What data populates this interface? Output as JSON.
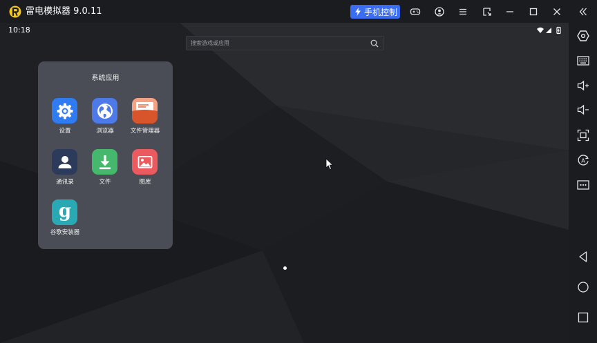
{
  "window": {
    "title": "雷电模拟器 9.0.11",
    "phone_control_label": "手机控制",
    "accent_color": "#3b6df2",
    "logo_color": "#f5c518",
    "buttons": [
      "gamepad-icon",
      "user-icon",
      "menu-icon",
      "screen-resize-icon",
      "minimize-icon",
      "maximize-icon",
      "close-icon",
      "collapse-sidebar-icon"
    ]
  },
  "status_bar": {
    "time": "10:18",
    "icons": [
      "wifi-icon",
      "signal-icon",
      "battery-icon"
    ]
  },
  "search": {
    "placeholder": "搜索游戏或应用"
  },
  "folder": {
    "title": "系统应用",
    "apps": [
      {
        "label": "设置",
        "icon": "settings-gear-icon",
        "color": "#2f7bf1"
      },
      {
        "label": "浏览器",
        "icon": "globe-icon",
        "color": "#4d7ae8"
      },
      {
        "label": "文件管理器",
        "icon": "folder-files-icon",
        "color": "#e56a3f"
      },
      {
        "label": "通讯录",
        "icon": "contact-person-icon",
        "color": "#2c3a5c"
      },
      {
        "label": "文件",
        "icon": "download-icon",
        "color": "#46b86e"
      },
      {
        "label": "图库",
        "icon": "gallery-image-icon",
        "color": "#ea5a5e"
      },
      {
        "label": "谷歌安装器",
        "icon": "google-g-icon",
        "color": "#28a9b4"
      }
    ]
  },
  "sidebar": {
    "buttons": [
      "settings-hexagon-icon",
      "keyboard-icon",
      "volume-up-icon",
      "volume-down-icon",
      "screenshot-icon",
      "auto-rotate-icon",
      "more-icon",
      "back-icon",
      "home-icon",
      "recents-icon"
    ]
  }
}
